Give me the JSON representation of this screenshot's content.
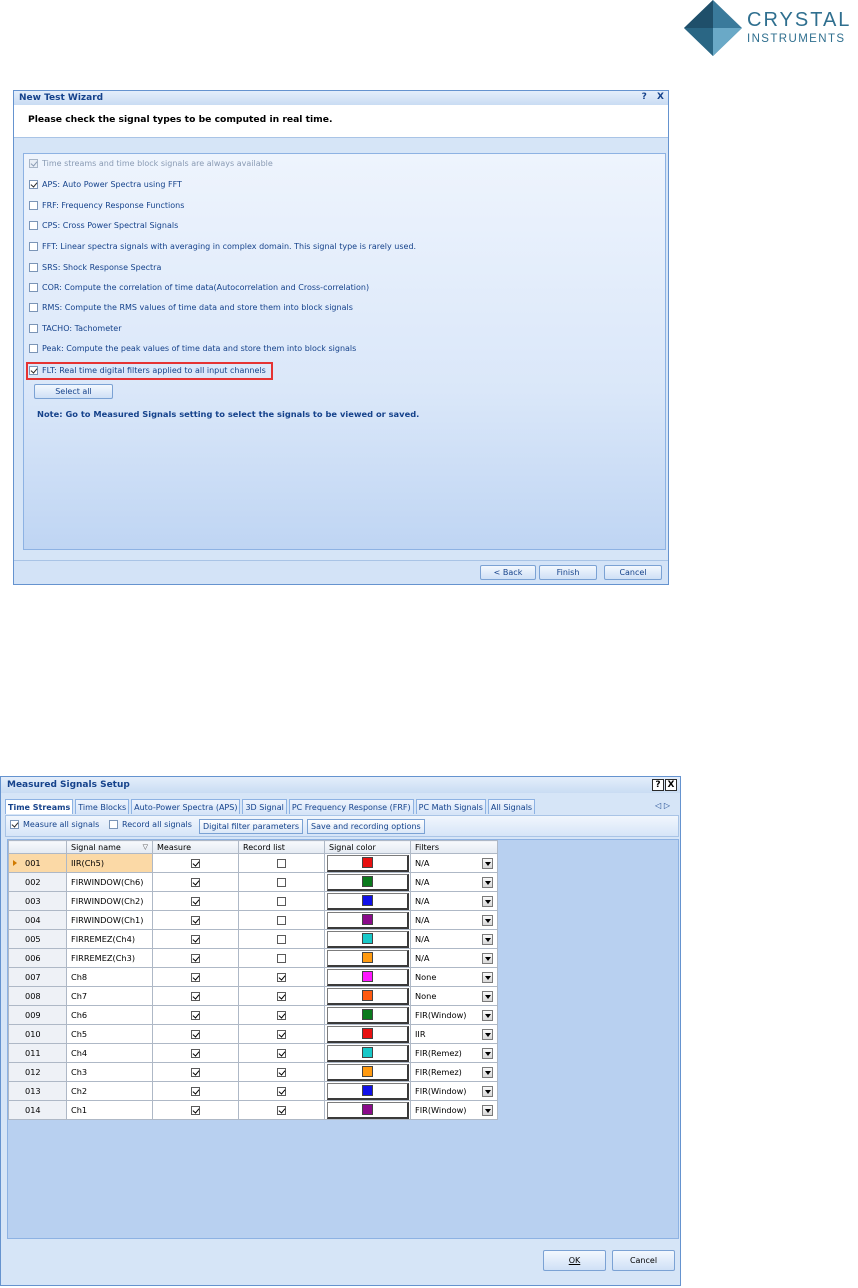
{
  "logo": {
    "line1": "CRYSTAL",
    "line2": "INSTRUMENTS"
  },
  "wizard": {
    "title": "New Test Wizard",
    "help": "?",
    "close": "X",
    "header": "Please check the signal types to be computed in real time.",
    "options": [
      {
        "label": "Time streams and time block signals are always available",
        "checked": true,
        "disabled": true
      },
      {
        "label": "APS: Auto Power Spectra using FFT",
        "checked": true,
        "disabled": false
      },
      {
        "label": "FRF: Frequency Response Functions",
        "checked": false,
        "disabled": false
      },
      {
        "label": "CPS: Cross Power Spectral Signals",
        "checked": false,
        "disabled": false
      },
      {
        "label": "FFT: Linear spectra signals with averaging in complex domain. This signal type is rarely used.",
        "checked": false,
        "disabled": false
      },
      {
        "label": "SRS: Shock Response Spectra",
        "checked": false,
        "disabled": false
      },
      {
        "label": "COR: Compute the correlation of time data(Autocorrelation and Cross-correlation)",
        "checked": false,
        "disabled": false
      },
      {
        "label": "RMS: Compute the RMS values of time data and store them into block signals",
        "checked": false,
        "disabled": false
      },
      {
        "label": "TACHO: Tachometer",
        "checked": false,
        "disabled": false
      },
      {
        "label": "Peak: Compute the peak values of time data and store them into block signals",
        "checked": false,
        "disabled": false
      },
      {
        "label": "FLT: Real time digital filters applied to all input channels",
        "checked": true,
        "disabled": false
      }
    ],
    "select_all": "Select all",
    "note": "Note: Go to Measured Signals setting to select the signals to be viewed or saved.",
    "buttons": {
      "back": "< Back",
      "finish": "Finish",
      "cancel": "Cancel"
    }
  },
  "measured": {
    "title": "Measured Signals Setup",
    "help": "?",
    "close": "X",
    "tabs": [
      "Time Streams",
      "Time Blocks",
      "Auto-Power Spectra (APS)",
      "3D Signal",
      "PC Frequency Response (FRF)",
      "PC Math Signals",
      "All Signals"
    ],
    "tab_arrows": "◁ ▷",
    "toolbar": {
      "measure_all": "Measure all signals",
      "record_all": "Record all signals",
      "digital_filter": "Digital filter parameters",
      "save_recording": "Save and recording options"
    },
    "columns": [
      "Signal name",
      "Measure",
      "Record list",
      "Signal color",
      "Filters"
    ],
    "rows": [
      {
        "num": "001",
        "name": "IIR(Ch5)",
        "measure": true,
        "record": false,
        "color": "#e81010",
        "filter": "N/A"
      },
      {
        "num": "002",
        "name": "FIRWINDOW(Ch6)",
        "measure": true,
        "record": false,
        "color": "#0a7a1c",
        "filter": "N/A"
      },
      {
        "num": "003",
        "name": "FIRWINDOW(Ch2)",
        "measure": true,
        "record": false,
        "color": "#1010e8",
        "filter": "N/A"
      },
      {
        "num": "004",
        "name": "FIRWINDOW(Ch1)",
        "measure": true,
        "record": false,
        "color": "#8a0a8a",
        "filter": "N/A"
      },
      {
        "num": "005",
        "name": "FIRREMEZ(Ch4)",
        "measure": true,
        "record": false,
        "color": "#18c8c8",
        "filter": "N/A"
      },
      {
        "num": "006",
        "name": "FIRREMEZ(Ch3)",
        "measure": true,
        "record": false,
        "color": "#ff9a10",
        "filter": "N/A"
      },
      {
        "num": "007",
        "name": "Ch8",
        "measure": true,
        "record": true,
        "color": "#ff18ff",
        "filter": "None"
      },
      {
        "num": "008",
        "name": "Ch7",
        "measure": true,
        "record": true,
        "color": "#ff5a10",
        "filter": "None"
      },
      {
        "num": "009",
        "name": "Ch6",
        "measure": true,
        "record": true,
        "color": "#0a7a1c",
        "filter": "FIR(Window)"
      },
      {
        "num": "010",
        "name": "Ch5",
        "measure": true,
        "record": true,
        "color": "#e81010",
        "filter": "IIR"
      },
      {
        "num": "011",
        "name": "Ch4",
        "measure": true,
        "record": true,
        "color": "#18c8c8",
        "filter": "FIR(Remez)"
      },
      {
        "num": "012",
        "name": "Ch3",
        "measure": true,
        "record": true,
        "color": "#ff9a10",
        "filter": "FIR(Remez)"
      },
      {
        "num": "013",
        "name": "Ch2",
        "measure": true,
        "record": true,
        "color": "#1010e8",
        "filter": "FIR(Window)"
      },
      {
        "num": "014",
        "name": "Ch1",
        "measure": true,
        "record": true,
        "color": "#8a0a8a",
        "filter": "FIR(Window)"
      }
    ],
    "buttons": {
      "ok": "OK",
      "cancel": "Cancel"
    }
  }
}
